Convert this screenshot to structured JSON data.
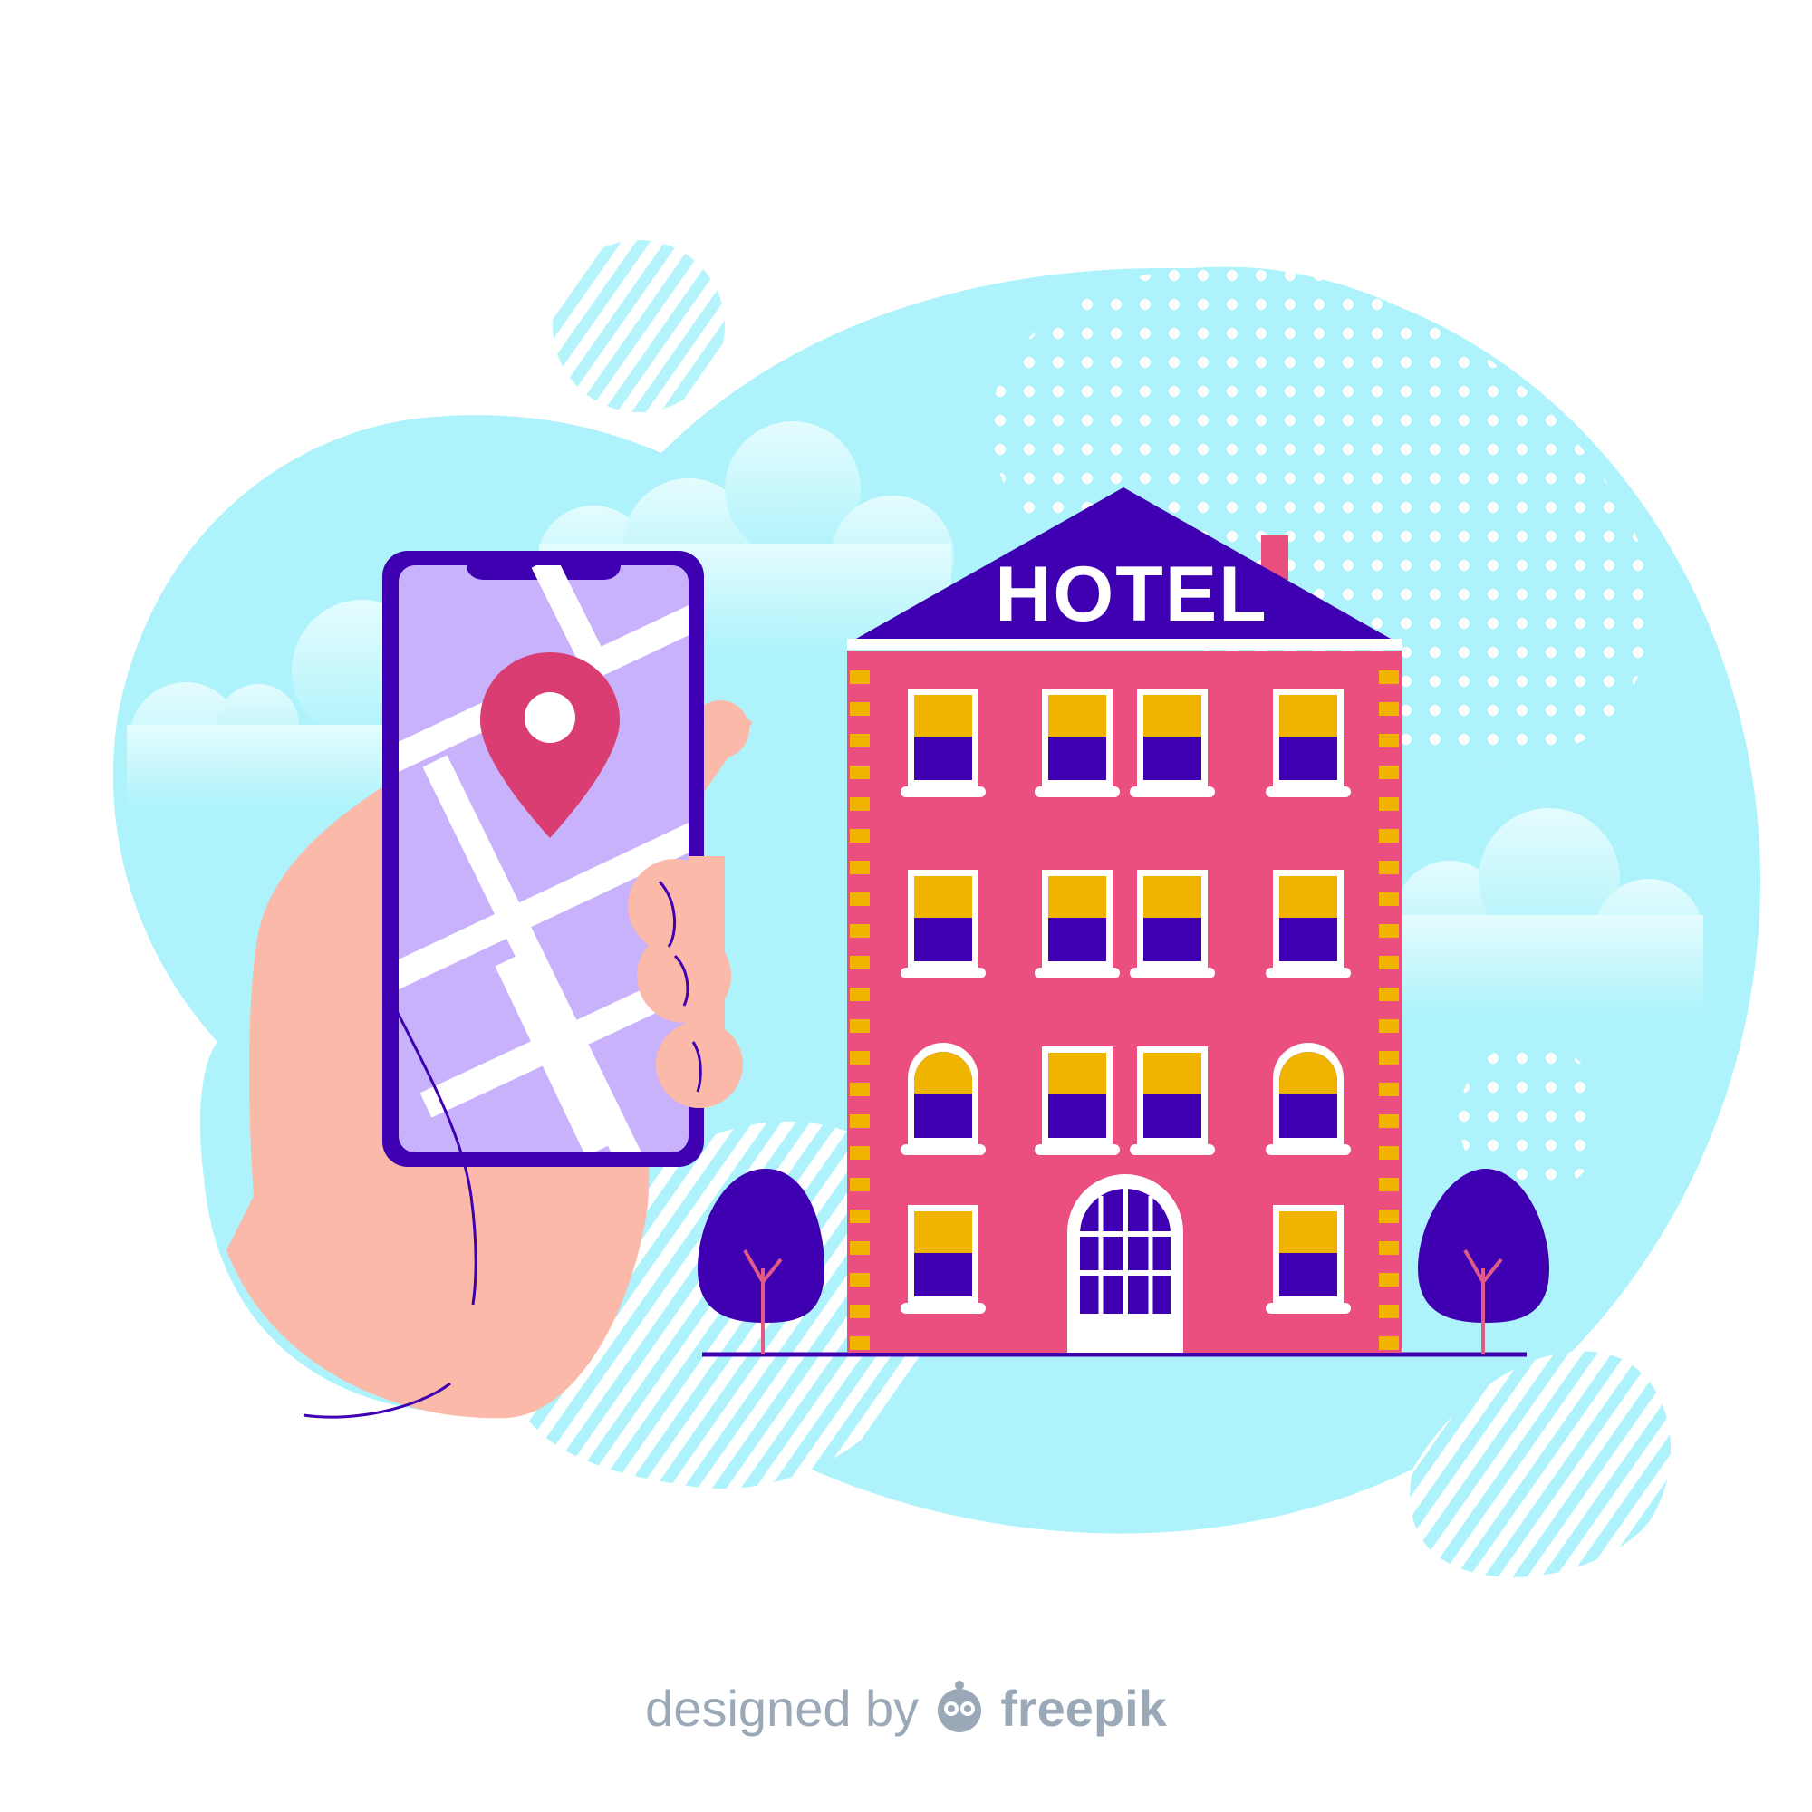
{
  "sign": {
    "text": "HOTEL"
  },
  "credit": {
    "prefix": "designed by",
    "brand": "freepik"
  },
  "colors": {
    "sky": "#aef3fb",
    "cloud": "#d6fafd",
    "building": "#ea4f7f",
    "roof": "#3f00b2",
    "window_top": "#f0b400",
    "window_bottom": "#3f00b2",
    "phone_screen": "#c8b2fb",
    "skin": "#fbb9a9",
    "pin": "#da3d72",
    "tree": "#3f00b2"
  },
  "icons": {
    "pin": "map-pin-icon",
    "logo": "freepik-logo-icon"
  }
}
